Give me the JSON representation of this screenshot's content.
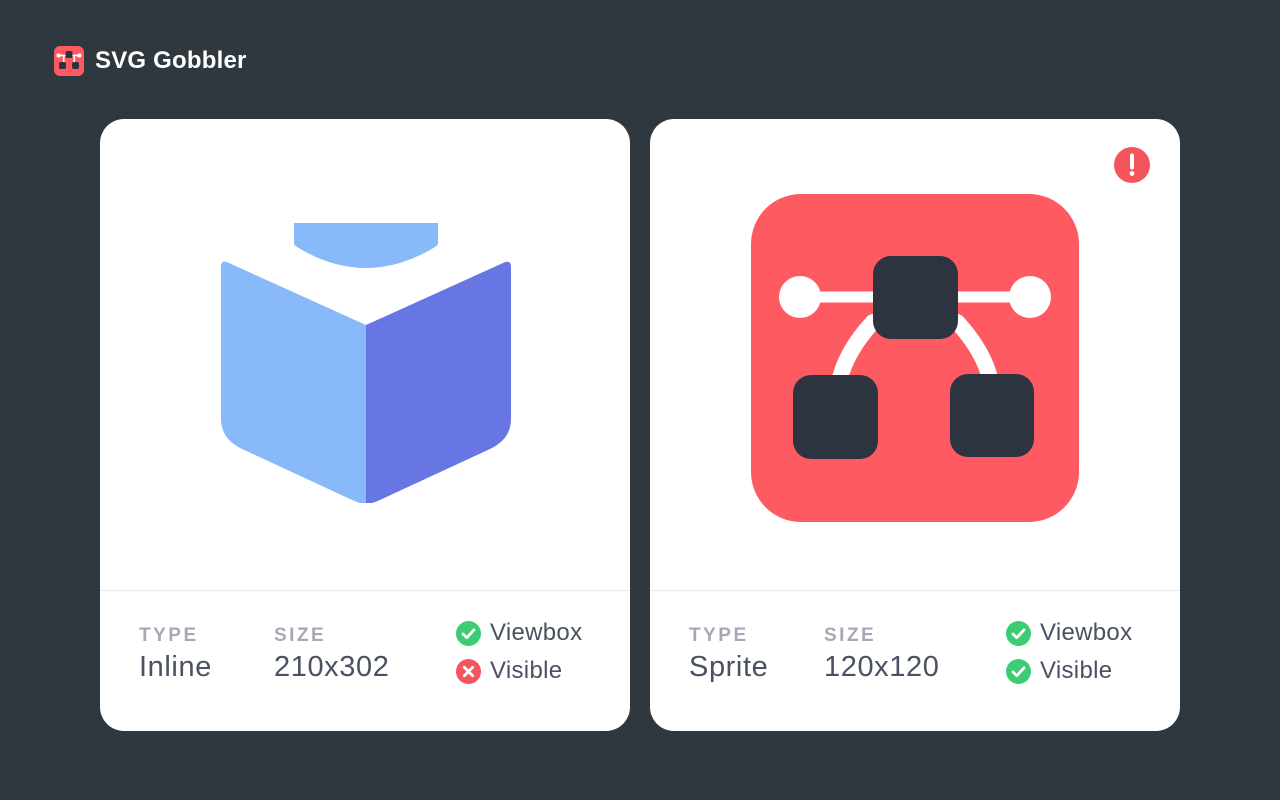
{
  "app": {
    "name": "SVG Gobbler",
    "logo_icon": "svg-gobbler-logo-icon"
  },
  "colors": {
    "background": "#2f383e",
    "card": "#ffffff",
    "success": "#3dcc74",
    "error": "#f4545c",
    "book_light": "#88baf9",
    "book_dark": "#6876e4",
    "vector_tile": "#fe5a61",
    "vector_node": "#2d3440"
  },
  "cards": [
    {
      "artwork_icon": "open-book-icon",
      "has_alert": false,
      "type_label": "TYPE",
      "type_value": "Inline",
      "size_label": "SIZE",
      "size_value": "210x302",
      "checks": [
        {
          "label": "Viewbox",
          "status": "pass",
          "icon": "check-circle-icon"
        },
        {
          "label": "Visible",
          "status": "fail",
          "icon": "x-circle-icon"
        }
      ]
    },
    {
      "artwork_icon": "vector-pen-nodes-icon",
      "has_alert": true,
      "alert_icon": "alert-circle-icon",
      "type_label": "TYPE",
      "type_value": "Sprite",
      "size_label": "SIZE",
      "size_value": "120x120",
      "checks": [
        {
          "label": "Viewbox",
          "status": "pass",
          "icon": "check-circle-icon"
        },
        {
          "label": "Visible",
          "status": "pass",
          "icon": "check-circle-icon"
        }
      ]
    }
  ]
}
